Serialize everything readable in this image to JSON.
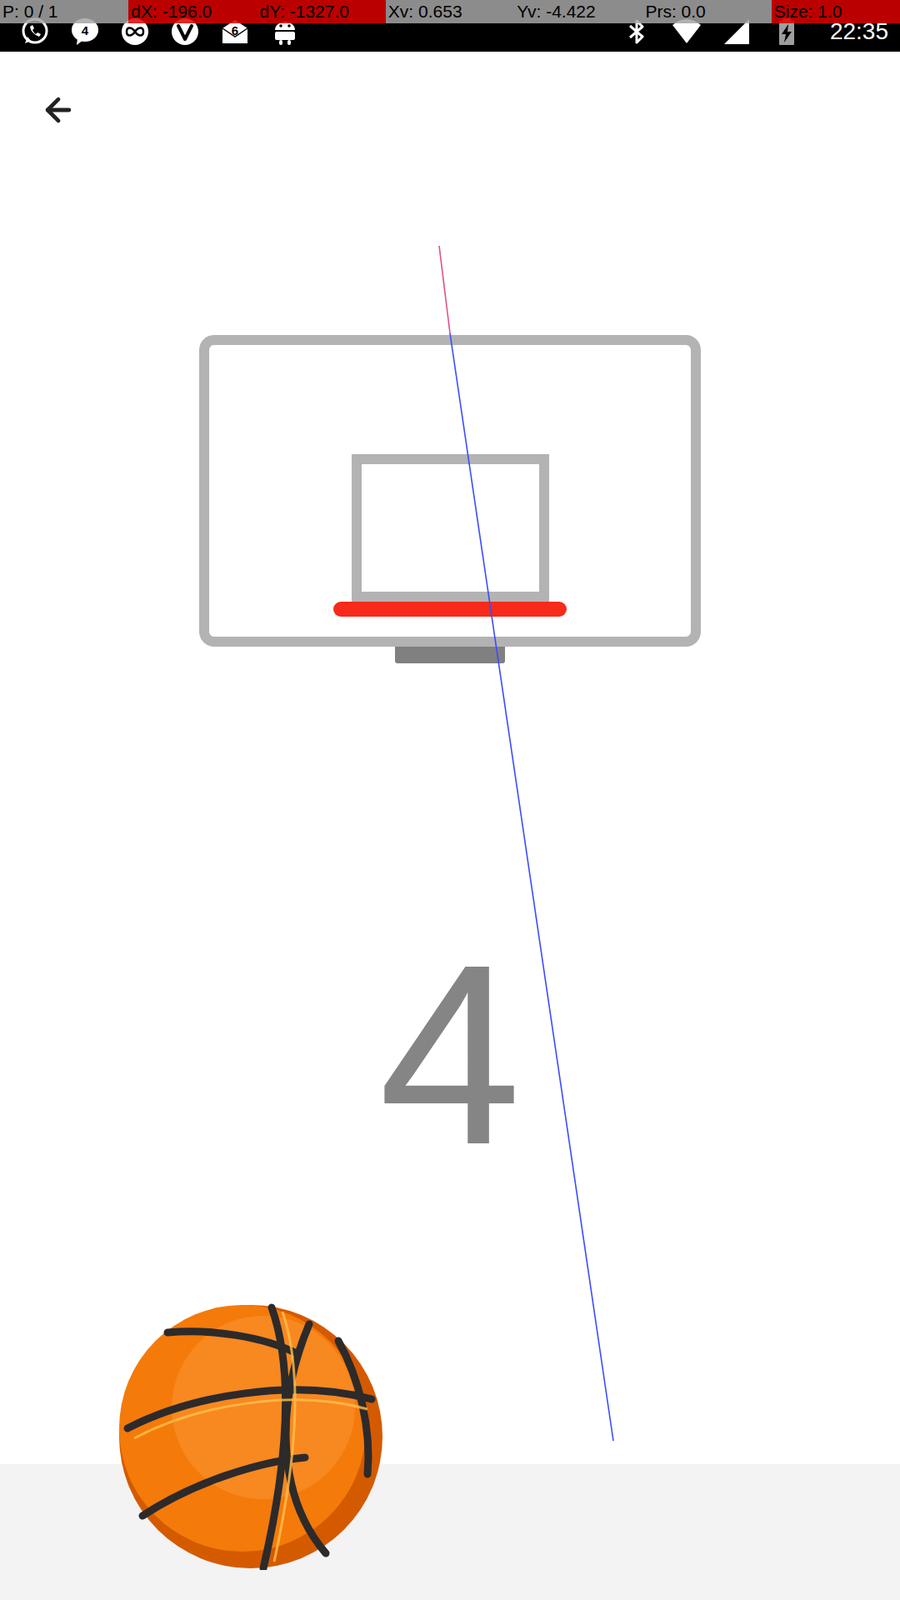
{
  "pointer_overlay": {
    "cells": [
      {
        "label": "P: 0 / 1",
        "highlighted": false
      },
      {
        "label": "dX: -196.0",
        "highlighted": true
      },
      {
        "label": "dY: -1327.0",
        "highlighted": true
      },
      {
        "label": "Xv: 0.653",
        "highlighted": false
      },
      {
        "label": "Yv: -4.422",
        "highlighted": false
      },
      {
        "label": "Prs: 0.0",
        "highlighted": false
      },
      {
        "label": "Size: 1.0",
        "highlighted": true
      }
    ]
  },
  "status_bar": {
    "notifications": [
      {
        "kind": "whatsapp",
        "badge": ""
      },
      {
        "kind": "messenger",
        "badge": "4"
      },
      {
        "kind": "infinity",
        "badge": ""
      },
      {
        "kind": "vivaldi",
        "badge": ""
      },
      {
        "kind": "mail",
        "badge": "6"
      },
      {
        "kind": "android",
        "badge": ""
      }
    ],
    "system": [
      {
        "kind": "bluetooth"
      },
      {
        "kind": "wifi"
      },
      {
        "kind": "signal"
      },
      {
        "kind": "battery",
        "charging": true
      }
    ],
    "time": "22:35"
  },
  "game": {
    "score": "4"
  }
}
